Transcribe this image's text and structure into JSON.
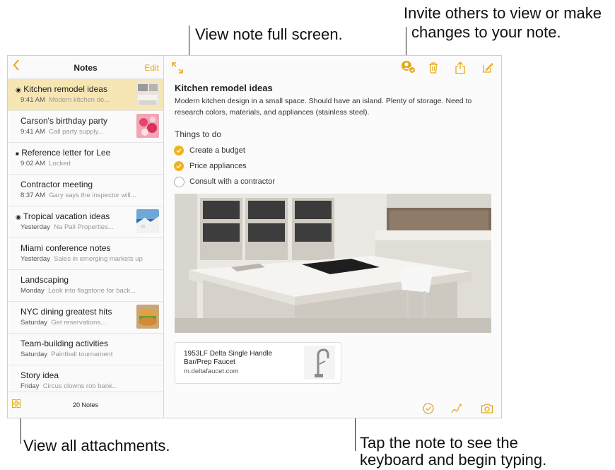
{
  "callouts": {
    "fullscreen": "View note full screen.",
    "invite_line1": "Invite others to view or make",
    "invite_line2": "changes to your note.",
    "attachments": "View all attachments.",
    "tap_line1": "Tap the note to see the",
    "tap_line2": "keyboard and begin typing."
  },
  "sidebar": {
    "title": "Notes",
    "back": "<",
    "edit": "Edit",
    "count": "20 Notes",
    "notes": [
      {
        "title": "Kitchen remodel ideas",
        "date": "9:41 AM",
        "snippet": "Modern kitchen de...",
        "marker": "shared"
      },
      {
        "title": "Carson's birthday party",
        "date": "9:41 AM",
        "snippet": "Call party supply...",
        "marker": ""
      },
      {
        "title": "Reference letter for Lee",
        "date": "9:02 AM",
        "snippet": "Locked",
        "marker": "locked"
      },
      {
        "title": "Contractor meeting",
        "date": "8:37 AM",
        "snippet": "Gary says the inspector will...",
        "marker": ""
      },
      {
        "title": "Tropical vacation ideas",
        "date": "Yesterday",
        "snippet": "Na Pali Properties...",
        "marker": "shared"
      },
      {
        "title": "Miami conference notes",
        "date": "Yesterday",
        "snippet": "Sales in emerging markets up",
        "marker": ""
      },
      {
        "title": "Landscaping",
        "date": "Monday",
        "snippet": "Look into flagstone for back...",
        "marker": ""
      },
      {
        "title": "NYC dining greatest hits",
        "date": "Saturday",
        "snippet": "Get reservations...",
        "marker": ""
      },
      {
        "title": "Team-building activities",
        "date": "Saturday",
        "snippet": "Paintball tournament",
        "marker": ""
      },
      {
        "title": "Story idea",
        "date": "Friday",
        "snippet": "Circus clowns rob bank...",
        "marker": ""
      }
    ]
  },
  "note": {
    "title": "Kitchen remodel ideas",
    "body": "Modern kitchen design in a small space. Should have an island. Plenty of storage. Need to research colors, materials, and appliances (stainless steel).",
    "checklist_title": "Things to do",
    "checklist": [
      {
        "label": "Create a budget",
        "done": true
      },
      {
        "label": "Price appliances",
        "done": true
      },
      {
        "label": "Consult with a contractor",
        "done": false
      }
    ],
    "link": {
      "title": "1953LF Delta Single Handle Bar/Prep Faucet",
      "url": "m.deltafaucet.com"
    }
  },
  "colors": {
    "accent": "#e6a817",
    "selected": "#f6e6b4",
    "check": "#f1b21e"
  },
  "icons": [
    "chevron-left-icon",
    "expand-icon",
    "add-people-icon",
    "trash-icon",
    "share-icon",
    "compose-icon",
    "attachments-grid-icon",
    "checklist-icon",
    "sketch-icon",
    "camera-icon"
  ]
}
